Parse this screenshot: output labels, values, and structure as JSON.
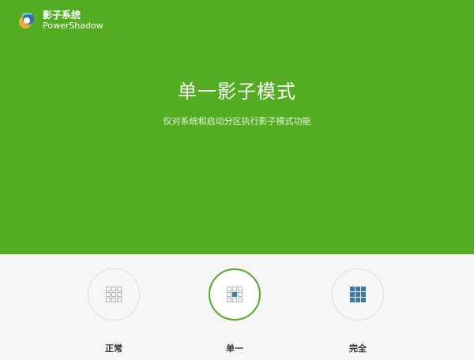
{
  "app": {
    "name": "影子系统",
    "subtitle": "PowerShadow"
  },
  "hero": {
    "title": "单一影子模式",
    "description": "仅对系统和启动分区执行影子模式功能"
  },
  "modes": [
    {
      "label": "正常",
      "icon": "grid-outline-icon",
      "active": false
    },
    {
      "label": "单一",
      "icon": "grid-center-icon",
      "active": true
    },
    {
      "label": "完全",
      "icon": "grid-filled-icon",
      "active": false
    }
  ],
  "colors": {
    "accent": "#53ac21",
    "icon_fill": "#3b7aa3"
  }
}
